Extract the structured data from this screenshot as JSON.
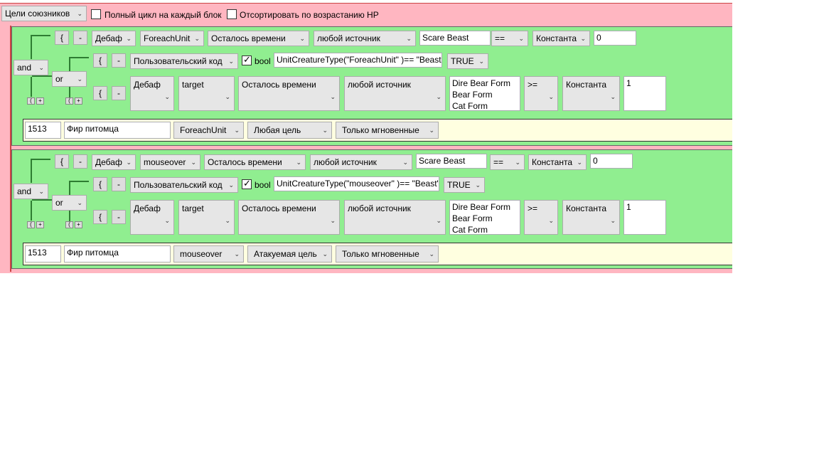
{
  "toolbar": {
    "target_select": "Цели союзников",
    "full_cycle_label": "Полный цикл на каждый блок",
    "sort_hp_label": "Отсортировать по возрастанию HP"
  },
  "blocks": [
    {
      "logic_op": "and",
      "sub_op": "or",
      "brace": "{",
      "minus": "-",
      "row1": {
        "type": "Дебаф",
        "unit": "ForeachUnit",
        "param": "Осталось времени",
        "source": "любой источник",
        "spell": "Scare Beast",
        "operator": "==",
        "const": "Константа",
        "value": "0"
      },
      "row2": {
        "type": "Пользовательский код",
        "bool_label": "bool",
        "code": "UnitCreatureType(\"ForeachUnit\" )== \"Beast\"",
        "result": "TRUE"
      },
      "row3": {
        "type": "Дебаф",
        "unit": "target",
        "param": "Осталось времени",
        "source": "любой источник",
        "spells": [
          "Dire Bear Form",
          "Bear Form",
          "Cat Form"
        ],
        "operator": ">=",
        "const": "Константа",
        "value": "1"
      },
      "action": {
        "id": "1513",
        "name": "Фир питомца",
        "unit": "ForeachUnit",
        "target": "Любая цель",
        "cast": "Только мгновенные"
      }
    },
    {
      "logic_op": "and",
      "sub_op": "or",
      "brace": "{",
      "minus": "-",
      "row1": {
        "type": "Дебаф",
        "unit": "mouseover",
        "param": "Осталось времени",
        "source": "любой источник",
        "spell": "Scare Beast",
        "operator": "==",
        "const": "Константа",
        "value": "0"
      },
      "row2": {
        "type": "Пользовательский код",
        "bool_label": "bool",
        "code": "UnitCreatureType(\"mouseover\" )== \"Beast\"",
        "result": "TRUE"
      },
      "row3": {
        "type": "Дебаф",
        "unit": "target",
        "param": "Осталось времени",
        "source": "любой источник",
        "spells": [
          "Dire Bear Form",
          "Bear Form",
          "Cat Form"
        ],
        "operator": ">=",
        "const": "Константа",
        "value": "1"
      },
      "action": {
        "id": "1513",
        "name": "Фир питомца",
        "unit": "mouseover",
        "target": "Атакуемая цель",
        "cast": "Только мгновенные"
      }
    }
  ],
  "icons": {
    "dropdown": "chevron-down-icon",
    "checkbox": "check-icon"
  },
  "colors": {
    "outer": "#ffb6c1",
    "block": "#90ee90",
    "action_row": "#ffffe0"
  }
}
